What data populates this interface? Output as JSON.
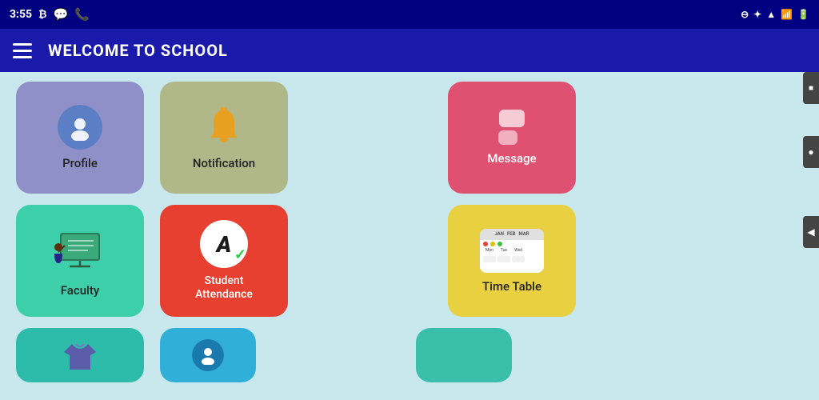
{
  "statusBar": {
    "time": "3:55",
    "rightIcons": [
      "battery",
      "wifi",
      "signal"
    ]
  },
  "topBar": {
    "title": "WELCOME TO SCHOOL"
  },
  "grid": {
    "rows": [
      [
        {
          "id": "profile",
          "label": "Profile",
          "color": "#9090c8"
        },
        {
          "id": "notification",
          "label": "Notification",
          "color": "#b0b88a"
        },
        {
          "id": "message",
          "label": "Message",
          "color": "#e05070"
        }
      ],
      [
        {
          "id": "faculty",
          "label": "Faculty",
          "color": "#3dcfaa"
        },
        {
          "id": "attendance",
          "label": "Student\nAttendance",
          "color": "#e84030"
        },
        {
          "id": "timetable",
          "label": "Time Table",
          "color": "#e8d040"
        }
      ]
    ],
    "bottomRow": [
      {
        "id": "bottom1",
        "label": "",
        "color": "#2dbcaa"
      },
      {
        "id": "bottom2",
        "label": "",
        "color": "#30b0d8"
      },
      {
        "id": "bottom3",
        "label": "",
        "color": "#3abfaa"
      }
    ]
  },
  "sideButtons": {
    "square": "■",
    "circle": "●",
    "triangle": "◀"
  }
}
